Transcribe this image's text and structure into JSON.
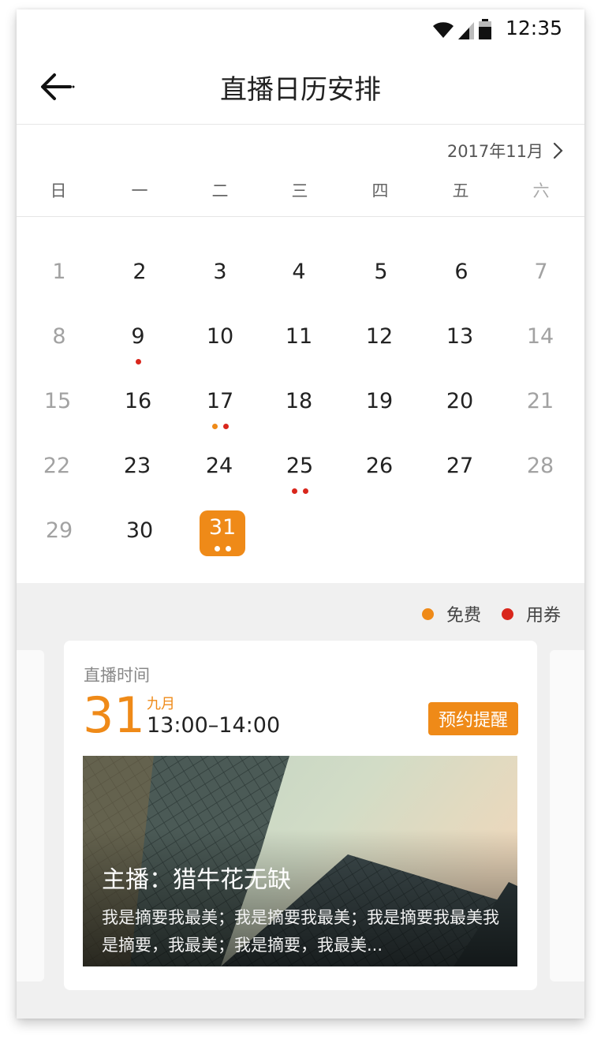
{
  "status_bar": {
    "time": "12:35"
  },
  "header": {
    "title": "直播日历安排"
  },
  "calendar": {
    "month_label": "2017年11月",
    "weekdays": [
      "日",
      "一",
      "二",
      "三",
      "四",
      "五",
      "六"
    ],
    "days": [
      "1",
      "2",
      "3",
      "4",
      "5",
      "6",
      "7",
      "8",
      "9",
      "10",
      "11",
      "12",
      "13",
      "14",
      "15",
      "16",
      "17",
      "18",
      "19",
      "20",
      "21",
      "22",
      "23",
      "24",
      "25",
      "26",
      "27",
      "28",
      "29",
      "30",
      "31"
    ],
    "selected_day": "31",
    "events": {
      "9": [
        "paid"
      ],
      "17": [
        "free",
        "paid"
      ],
      "25": [
        "paid",
        "paid"
      ],
      "31": [
        "white",
        "white"
      ]
    }
  },
  "legend": {
    "free": "免费",
    "paid": "用券"
  },
  "colors": {
    "accent": "#ef8a18",
    "free": "#ef8a18",
    "paid": "#d9261c"
  },
  "card": {
    "label": "直播时间",
    "day": "31",
    "month": "九月",
    "time": "13:00–14:00",
    "remind_button": "预约提醒",
    "anchor": "主播：猎牛花无缺",
    "summary": "我是摘要我最美；我是摘要我最美；我是摘要我最美我是摘要，我最美；我是摘要，我最美..."
  },
  "icons": {
    "back": "arrow-left-icon",
    "next_month": "chevron-right-icon",
    "wifi": "wifi-icon",
    "signal": "signal-icon",
    "battery": "battery-icon"
  }
}
